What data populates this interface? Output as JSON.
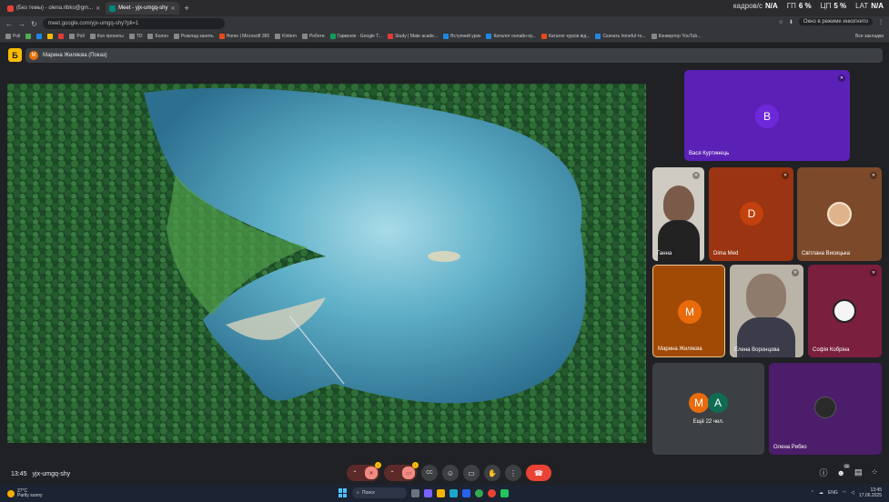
{
  "browser": {
    "tabs": [
      {
        "label": "(Без темы) - olena.ribko@gm...",
        "color": "#ea4335",
        "active": false
      },
      {
        "label": "Meet - yjx-umgq-shy",
        "color": "#00897b",
        "active": true
      }
    ],
    "new_tab": "+",
    "address": "meet.google.com/yjx-umgq-shy?pli=1",
    "incognito": "Окно в режиме инкогнито",
    "sysmon": [
      {
        "label": "кадров/с",
        "value": "N/A"
      },
      {
        "label": "ГП",
        "value": "6 %"
      },
      {
        "label": "ЦП",
        "value": "5 %"
      },
      {
        "label": "LAT",
        "value": "N/A"
      }
    ],
    "bookmarks": [
      {
        "label": "Poll",
        "color": "#888"
      },
      {
        "label": "",
        "color": "#4caf50"
      },
      {
        "label": "",
        "color": "#1e88e5"
      },
      {
        "label": "",
        "color": "#fbbc04"
      },
      {
        "label": "",
        "color": "#e53935"
      },
      {
        "label": "Poll",
        "color": "#888"
      },
      {
        "label": "Кол проекты",
        "color": "#888"
      },
      {
        "label": "TD",
        "color": "#888"
      },
      {
        "label": "Болон",
        "color": "#888"
      },
      {
        "label": "Розклад занять",
        "color": "#888"
      },
      {
        "label": "Home | Microsoft 365",
        "color": "#e64a19"
      },
      {
        "label": "Kintern",
        "color": "#888"
      },
      {
        "label": "Роботи",
        "color": "#888"
      },
      {
        "label": "Гармонія · Google Т...",
        "color": "#0f9d58"
      },
      {
        "label": "Study | Mate acade...",
        "color": "#e53935"
      },
      {
        "label": "Вступний урок",
        "color": "#1e88e5"
      },
      {
        "label": "Каталог онлайн-ку...",
        "color": "#1e88e5"
      },
      {
        "label": "Каталог курсів від...",
        "color": "#e64a19"
      },
      {
        "label": "Скачать #oneful то...",
        "color": "#1e88e5"
      },
      {
        "label": "Конвертор YouTub...",
        "color": "#888"
      }
    ],
    "all_bookmarks": "Все закладки"
  },
  "meet": {
    "present_icon": "Б",
    "presenter_initial": "М",
    "presenter_label": "Марина Жиляєва (Показ)",
    "meeting_time": "13:45",
    "meeting_code": "yjx-umgq-shy",
    "participants_count": "31",
    "participants": [
      {
        "name": "Вася Куртинець",
        "initial": "В",
        "bg": "#5b21b6",
        "avatar": "#6d28d9"
      },
      {
        "name": "Ганна",
        "initial": "",
        "bg": "#c9c4bd",
        "avatar": "#7a5a48"
      },
      {
        "name": "Dima Med",
        "initial": "D",
        "bg": "#9a3412",
        "avatar": "#c2410c"
      },
      {
        "name": "Світлана Висицька",
        "initial": "",
        "bg": "#7c4a2a",
        "avatar": "#e0b48a"
      },
      {
        "name": "Марина Жиляєва",
        "initial": "М",
        "bg": "#a04a05",
        "avatar": "#ea6b0c"
      },
      {
        "name": "Елена Воронцова",
        "initial": "",
        "bg": "#b9b3a8",
        "avatar": "#5a4a44"
      },
      {
        "name": "Софія Кобріна",
        "initial": "",
        "bg": "#7a1f3d",
        "avatar": "#f5f5f5"
      },
      {
        "name": "Олена Рибко",
        "initial": "",
        "bg": "#4c1d6b",
        "avatar": "#2a2a2a"
      }
    ],
    "more": {
      "label": "Ещё 22 чел.",
      "initials": [
        "М",
        "А"
      ],
      "colors": [
        "#ea6b0c",
        "#0f6b54"
      ]
    },
    "controls": {
      "raise_hand": "✋",
      "captions": "CC",
      "emoji": "☺",
      "present": "▭",
      "more": "⋮",
      "leave": "☎"
    }
  },
  "taskbar": {
    "temp": "27°C",
    "weather": "Partly sunny",
    "search": "Поиск",
    "lang": "ENG",
    "time": "13:45",
    "date": "17.06.2025"
  }
}
